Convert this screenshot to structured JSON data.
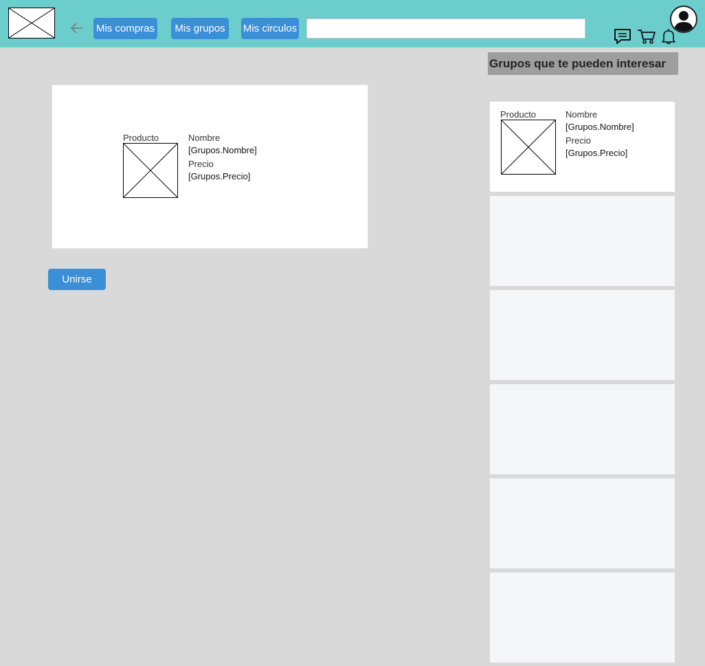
{
  "nav": {
    "buttons": [
      {
        "label": "Mis compras"
      },
      {
        "label": "Mis grupos"
      },
      {
        "label": "Mis circulos"
      }
    ],
    "search": {
      "value": "",
      "placeholder": ""
    }
  },
  "icons": {
    "logo": "image-placeholder-icon",
    "back": "arrow-left-icon",
    "chat": "chat-icon",
    "cart": "cart-icon",
    "bell": "bell-icon",
    "avatar": "user-avatar-icon"
  },
  "main": {
    "card": {
      "product_label": "Producto",
      "name_label": "Nombre",
      "name_value": "[Grupos.Nombre]",
      "price_label": "Precio",
      "price_value": "[Grupos.Precio]"
    },
    "join_label": "Unirse"
  },
  "sidebar": {
    "title": "Grupos que te pueden interesar",
    "cards": [
      {
        "product_label": "Producto",
        "name_label": "Nombre",
        "name_value": "[Grupos.Nombre]",
        "price_label": "Precio",
        "price_value": "[Grupos.Precio]"
      }
    ]
  },
  "colors": {
    "topbar": "#6ccdcd",
    "button": "#3a8fd6",
    "background": "#d9d9d9",
    "sidebar_title_bg": "#9e9e9e",
    "empty_card": "#f5f6f7"
  }
}
